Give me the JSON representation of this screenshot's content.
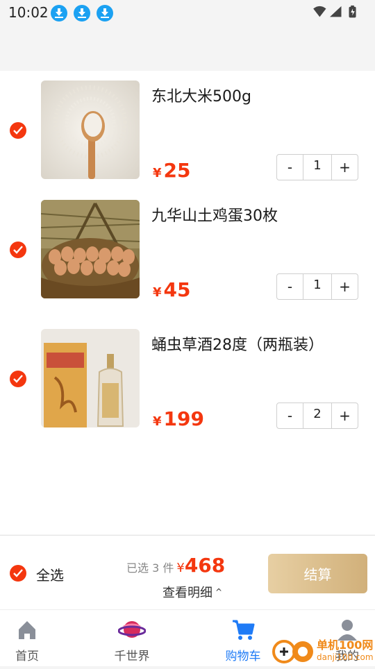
{
  "status_bar": {
    "time": "10:02",
    "download_icons": 3
  },
  "cart_items": [
    {
      "name": "东北大米500g",
      "currency": "¥",
      "price": "25",
      "quantity": "1"
    },
    {
      "name": "九华山土鸡蛋30枚",
      "currency": "¥",
      "price": "45",
      "quantity": "1"
    },
    {
      "name": "蛹虫草酒28度（两瓶装）",
      "currency": "¥",
      "price": "199",
      "quantity": "2"
    }
  ],
  "stepper": {
    "minus": "-",
    "plus": "+"
  },
  "checkout": {
    "select_all_label": "全选",
    "selected_count_text": "已选 3 件",
    "currency": "¥",
    "total": "468",
    "details_label": "查看明细",
    "details_caret": "^",
    "pay_label": "结算"
  },
  "tabbar": [
    {
      "label": "首页",
      "icon": "home-icon"
    },
    {
      "label": "千世界",
      "icon": "planet-icon"
    },
    {
      "label": "购物车",
      "icon": "cart-icon",
      "active": true
    },
    {
      "label": "我的",
      "icon": "user-icon"
    }
  ],
  "watermark": {
    "line1": "单机100网",
    "line2": "danji100.com"
  },
  "colors": {
    "accent": "#f4370f",
    "active_tab": "#1f7bf6",
    "pay_gold": "#d9bd8c"
  }
}
